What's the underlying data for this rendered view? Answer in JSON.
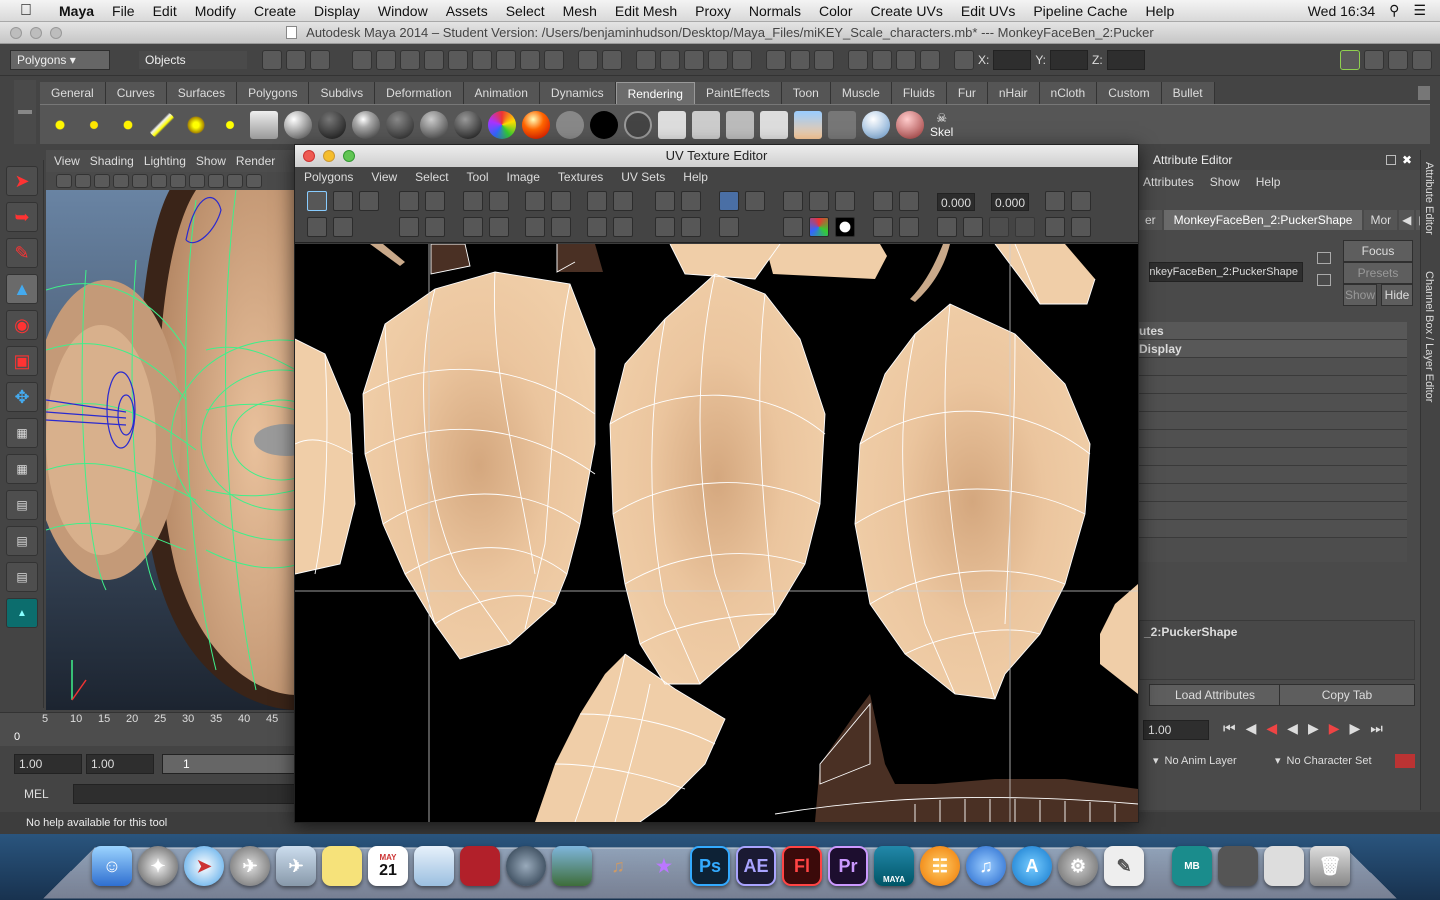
{
  "menubar": {
    "app": "Maya",
    "items": [
      "File",
      "Edit",
      "Modify",
      "Create",
      "Display",
      "Window",
      "Assets",
      "Select",
      "Mesh",
      "Edit Mesh",
      "Proxy",
      "Normals",
      "Color",
      "Create UVs",
      "Edit UVs",
      "Pipeline Cache",
      "Help"
    ],
    "clock": "Wed 16:34"
  },
  "window": {
    "title": "Autodesk Maya 2014 – Student Version: /Users/benjaminhudson/Desktop/Maya_Files/miKEY_Scale_characters.mb*   ---   MonkeyFaceBen_2:Pucker"
  },
  "statusline": {
    "mode": "Polygons",
    "selmode": "Objects",
    "x_label": "X:",
    "y_label": "Y:",
    "z_label": "Z:"
  },
  "shelf": {
    "tabs": [
      "General",
      "Curves",
      "Surfaces",
      "Polygons",
      "Subdivs",
      "Deformation",
      "Animation",
      "Dynamics",
      "Rendering",
      "PaintEffects",
      "Toon",
      "Muscle",
      "Fluids",
      "Fur",
      "nHair",
      "nCloth",
      "Custom",
      "Bullet"
    ],
    "active": "Rendering",
    "skel_label": "Skel"
  },
  "viewport": {
    "menu": [
      "View",
      "Shading",
      "Lighting",
      "Show",
      "Render"
    ]
  },
  "timeline": {
    "ticks": [
      "5",
      "10",
      "15",
      "20",
      "25",
      "30",
      "35",
      "40",
      "45"
    ],
    "current": "0",
    "range_start": "1.00",
    "range_start2": "1.00",
    "range_frame": "1"
  },
  "mel": {
    "label": "MEL"
  },
  "help": {
    "text": "No help available for this tool"
  },
  "uv_editor": {
    "title": "UV Texture Editor",
    "menu": [
      "Polygons",
      "View",
      "Select",
      "Tool",
      "Image",
      "Textures",
      "UV Sets",
      "Help"
    ],
    "u_value": "0.000",
    "v_value": "0.000"
  },
  "attribute_editor": {
    "title": "Attribute Editor",
    "menu": [
      "Attributes",
      "Show",
      "Help"
    ],
    "tab_partial": "er",
    "tab_active": "MonkeyFaceBen_2:PuckerShape",
    "tab_more": "Mor",
    "node_name": "nkeyFaceBen_2:PuckerShape",
    "focus": "Focus",
    "presets": "Presets",
    "show": "Show",
    "hide": "Hide",
    "section1": "utes",
    "section2": "Display",
    "footer_node": "_2:PuckerShape",
    "load_attributes": "Load Attributes",
    "copy_tab": "Copy Tab",
    "end_value": "1.00",
    "anim_layer": "No Anim Layer",
    "character_set": "No Character Set"
  },
  "side_tabs": [
    "Attribute Editor",
    "Channel Box / Layer Editor"
  ],
  "dock": {
    "apps": [
      "Finder",
      "Launchpad",
      "Safari",
      "Rocket",
      "Preview",
      "Stickies",
      "Calendar",
      "Mail",
      "Photo Booth",
      "Image Capture",
      "iPhoto",
      "GarageBand",
      "iMovie",
      "Ps",
      "AE",
      "Fl",
      "Pr",
      "Maya",
      "iBooks",
      "iTunes",
      "App Store",
      "System Preferences",
      "TextEdit",
      "MB",
      "AE-export",
      "Remote",
      "Trash"
    ],
    "calendar_day": "21",
    "calendar_month": "MAY",
    "maya_label": "MAYA",
    "ps_label": "Ps",
    "ae_label": "AE",
    "fl_label": "Fl",
    "pr_label": "Pr",
    "mb_label": "MB"
  },
  "colors": {
    "skin": "#f0cea8",
    "skin_dark": "#d4a77e",
    "uv_bg": "#000000",
    "dark_brown": "#4a3024",
    "wire": "#ffffff",
    "viewport_wire": "#3ff08a",
    "maya_bg": "#444444"
  }
}
